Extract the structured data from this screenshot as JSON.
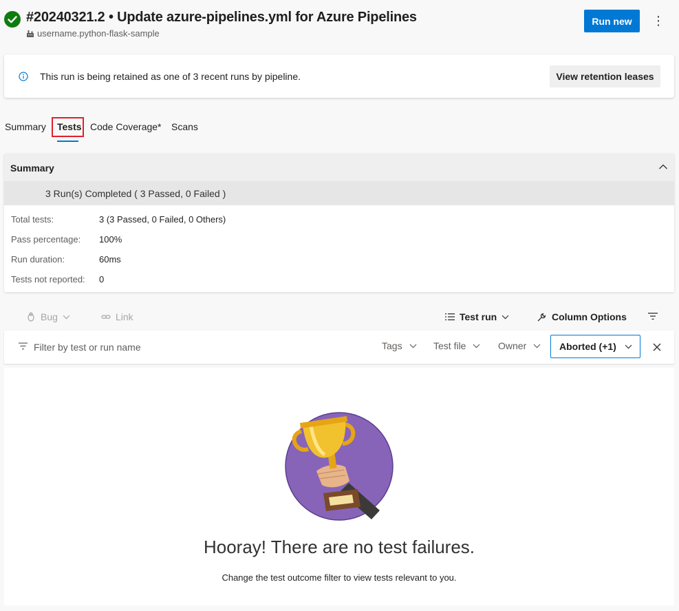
{
  "header": {
    "title": "#20240321.2 • Update azure-pipelines.yml for Azure Pipelines",
    "repo": "username.python-flask-sample",
    "run_new_label": "Run new",
    "more_glyph": "⋮"
  },
  "banner": {
    "text": "This run is being retained as one of 3 recent runs by pipeline.",
    "button_label": "View retention leases"
  },
  "tabs": [
    {
      "label": "Summary",
      "selected": false
    },
    {
      "label": "Tests",
      "selected": true
    },
    {
      "label": "Code Coverage*",
      "selected": false
    },
    {
      "label": "Scans",
      "selected": false
    }
  ],
  "summary": {
    "title": "Summary",
    "runs_text": "3 Run(s) Completed ( 3 Passed, 0 Failed )",
    "stats": [
      {
        "label": "Total tests:",
        "value": "3 (3 Passed, 0 Failed, 0 Others)"
      },
      {
        "label": "Pass percentage:",
        "value": "100%"
      },
      {
        "label": "Run duration:",
        "value": "60ms"
      },
      {
        "label": "Tests not reported:",
        "value": "0"
      }
    ]
  },
  "toolbar": {
    "bug_label": "Bug",
    "link_label": "Link",
    "test_run_label": "Test run",
    "column_options_label": "Column Options"
  },
  "filters": {
    "search_placeholder": "Filter by test or run name",
    "tags_label": "Tags",
    "test_file_label": "Test file",
    "owner_label": "Owner",
    "outcome_label": "Aborted (+1)"
  },
  "empty_state": {
    "heading": "Hooray! There are no test failures.",
    "hint": "Change the test outcome filter to view tests relevant to you."
  },
  "colors": {
    "accent": "#0078d4",
    "success": "#107c10",
    "highlight": "#e0202a",
    "trophy_circle": "#8764b8"
  }
}
